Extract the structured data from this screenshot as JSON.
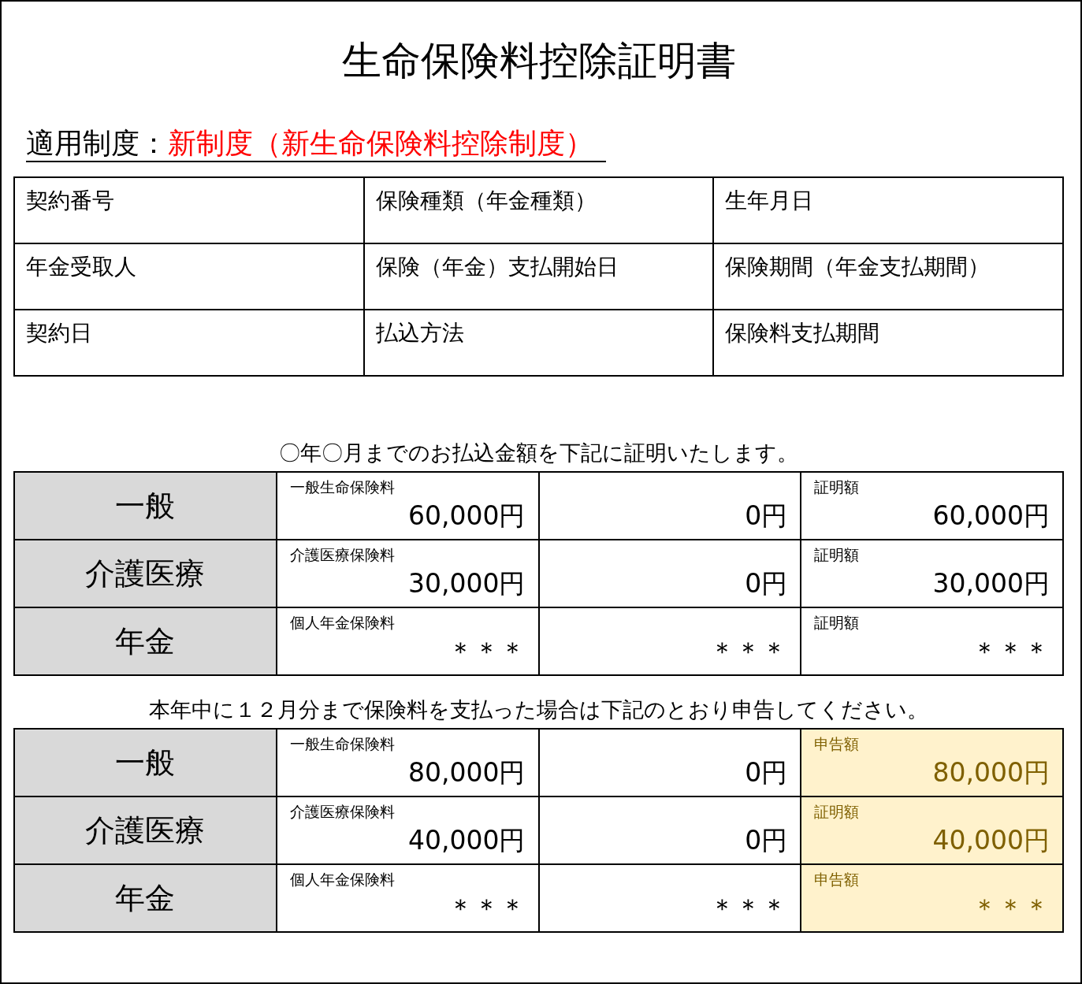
{
  "title": "生命保険料控除証明書",
  "system": {
    "label": "適用制度：",
    "value": "新制度（新生命保険料控除制度）"
  },
  "contract_info": [
    [
      "契約番号",
      "保険種類（年金種類）",
      "生年月日"
    ],
    [
      "年金受取人",
      "保険（年金）支払開始日",
      "保険期間（年金支払期間）"
    ],
    [
      "契約日",
      "払込方法",
      "保険料支払期間"
    ]
  ],
  "sections": [
    {
      "note": "〇年〇月までのお払込金額を下記に証明いたします。",
      "highlighted": false,
      "rows": [
        {
          "category": "一般",
          "premium_label": "一般生命保険料",
          "premium": "60,000円",
          "column_3": "0円",
          "result_label": "証明額",
          "result": "60,000円"
        },
        {
          "category": "介護医療",
          "premium_label": "介護医療保険料",
          "premium": "30,000円",
          "column_3": "0円",
          "result_label": "証明額",
          "result": "30,000円"
        },
        {
          "category": "年金",
          "premium_label": "個人年金保険料",
          "premium": "＊＊＊",
          "column_3": "＊＊＊",
          "result_label": "証明額",
          "result": "＊＊＊"
        }
      ]
    },
    {
      "note": "本年中に１２月分まで保険料を支払った場合は下記のとおり申告してください。",
      "highlighted": true,
      "rows": [
        {
          "category": "一般",
          "premium_label": "一般生命保険料",
          "premium": "80,000円",
          "column_3": "0円",
          "result_label": "申告額",
          "result": "80,000円"
        },
        {
          "category": "介護医療",
          "premium_label": "介護医療保険料",
          "premium": "40,000円",
          "column_3": "0円",
          "result_label": "証明額",
          "result": "40,000円"
        },
        {
          "category": "年金",
          "premium_label": "個人年金保険料",
          "premium": "＊＊＊",
          "column_3": "＊＊＊",
          "result_label": "申告額",
          "result": "＊＊＊"
        }
      ]
    }
  ]
}
